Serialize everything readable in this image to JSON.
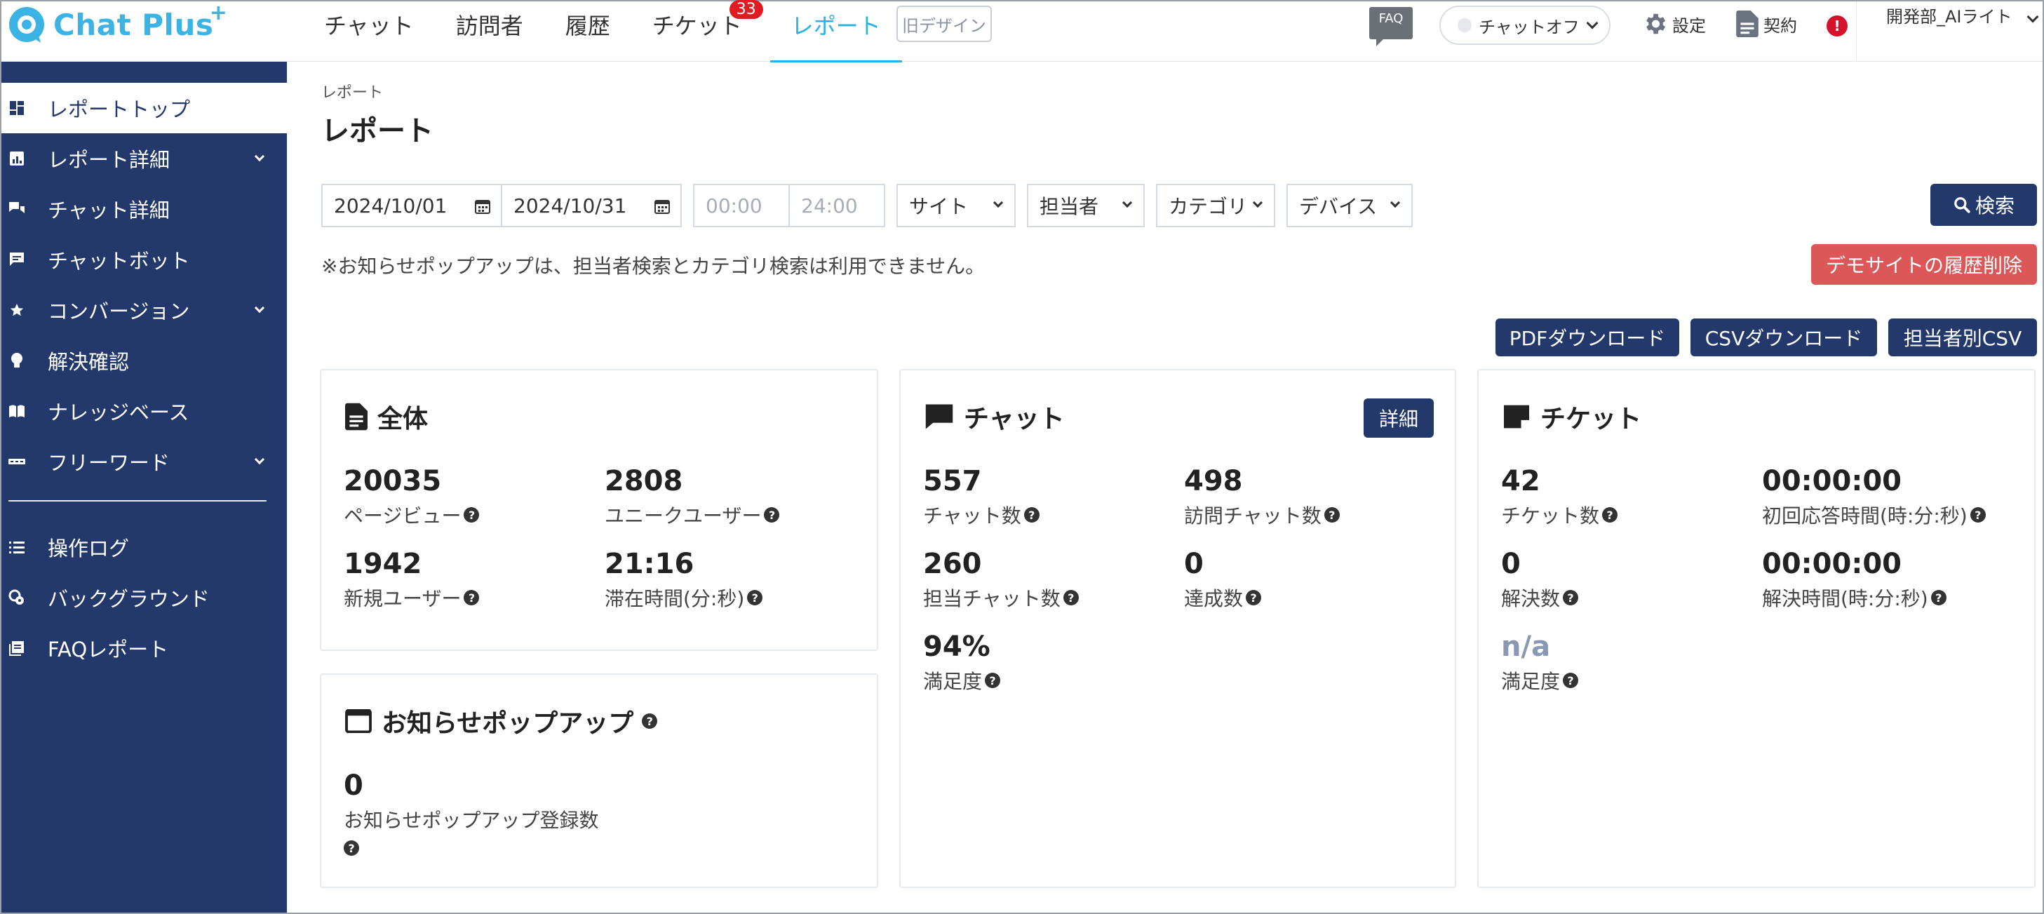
{
  "header": {
    "logo_text": "Chat Plus",
    "logo_plus": "+",
    "nav": [
      {
        "label": "チャット"
      },
      {
        "label": "訪問者"
      },
      {
        "label": "履歴"
      },
      {
        "label": "チケット",
        "badge": "33"
      },
      {
        "label": "レポート",
        "active": true
      }
    ],
    "old_design": "旧デザイン",
    "faq": "FAQ",
    "chat_status": "チャットオフ",
    "settings": "設定",
    "contract": "契約",
    "alert": "!",
    "user": "開発部_AIライト",
    "user_tail": "ト"
  },
  "sidebar": {
    "items": [
      {
        "label": "レポートトップ",
        "icon": "dashboard-icon",
        "active": true
      },
      {
        "label": "レポート詳細",
        "icon": "report-icon",
        "expandable": true
      },
      {
        "label": "チャット詳細",
        "icon": "chat-bubbles-icon"
      },
      {
        "label": "チャットボット",
        "icon": "bot-message-icon"
      },
      {
        "label": "コンバージョン",
        "icon": "star-icon",
        "expandable": true
      },
      {
        "label": "解決確認",
        "icon": "lightbulb-icon"
      },
      {
        "label": "ナレッジベース",
        "icon": "book-icon"
      },
      {
        "label": "フリーワード",
        "icon": "abc-icon",
        "expandable": true
      },
      {
        "label": "操作ログ",
        "icon": "list-icon"
      },
      {
        "label": "バックグラウンド",
        "icon": "background-gear-icon"
      },
      {
        "label": "FAQレポート",
        "icon": "faq-report-icon"
      }
    ]
  },
  "main": {
    "breadcrumb": "レポート",
    "title": "レポート",
    "filters": {
      "date_from": "2024/10/01",
      "date_to": "2024/10/31",
      "time_from_placeholder": "00:00",
      "time_to_placeholder": "24:00",
      "site": "サイト",
      "agent": "担当者",
      "category": "カテゴリ",
      "device": "デバイス"
    },
    "search_button": "検索",
    "notice": "※お知らせポップアップは、担当者検索とカテゴリ検索は利用できません。",
    "delete_history_button": "デモサイトの履歴削除",
    "pdf_button": "PDFダウンロード",
    "csv_button": "CSVダウンロード",
    "agent_csv_button": "担当者別CSV"
  },
  "cards": {
    "overall": {
      "title": "全体",
      "metrics": [
        {
          "value": "20035",
          "label": "ページビュー"
        },
        {
          "value": "2808",
          "label": "ユニークユーザー"
        },
        {
          "value": "1942",
          "label": "新規ユーザー"
        },
        {
          "value": "21:16",
          "label": "滞在時間(分:秒)"
        }
      ]
    },
    "popup": {
      "title": "お知らせポップアップ",
      "metrics": [
        {
          "value": "0",
          "label": "お知らせポップアップ登録数"
        }
      ]
    },
    "chat": {
      "title": "チャット",
      "detail_button": "詳細",
      "metrics": [
        {
          "value": "557",
          "label": "チャット数"
        },
        {
          "value": "498",
          "label": "訪問チャット数"
        },
        {
          "value": "260",
          "label": "担当チャット数"
        },
        {
          "value": "0",
          "label": "達成数"
        },
        {
          "value": "94%",
          "label": "満足度"
        }
      ]
    },
    "ticket": {
      "title": "チケット",
      "metrics": [
        {
          "value": "42",
          "label": "チケット数"
        },
        {
          "value": "00:00:00",
          "label": "初回応答時間(時:分:秒)"
        },
        {
          "value": "0",
          "label": "解決数"
        },
        {
          "value": "00:00:00",
          "label": "解決時間(時:分:秒)"
        },
        {
          "value": "n/a",
          "label": "満足度"
        }
      ]
    }
  },
  "colors": {
    "brand": "#3bb3e4",
    "sidebar": "#23386b",
    "danger": "#dc5757",
    "badge": "#e11b22"
  }
}
